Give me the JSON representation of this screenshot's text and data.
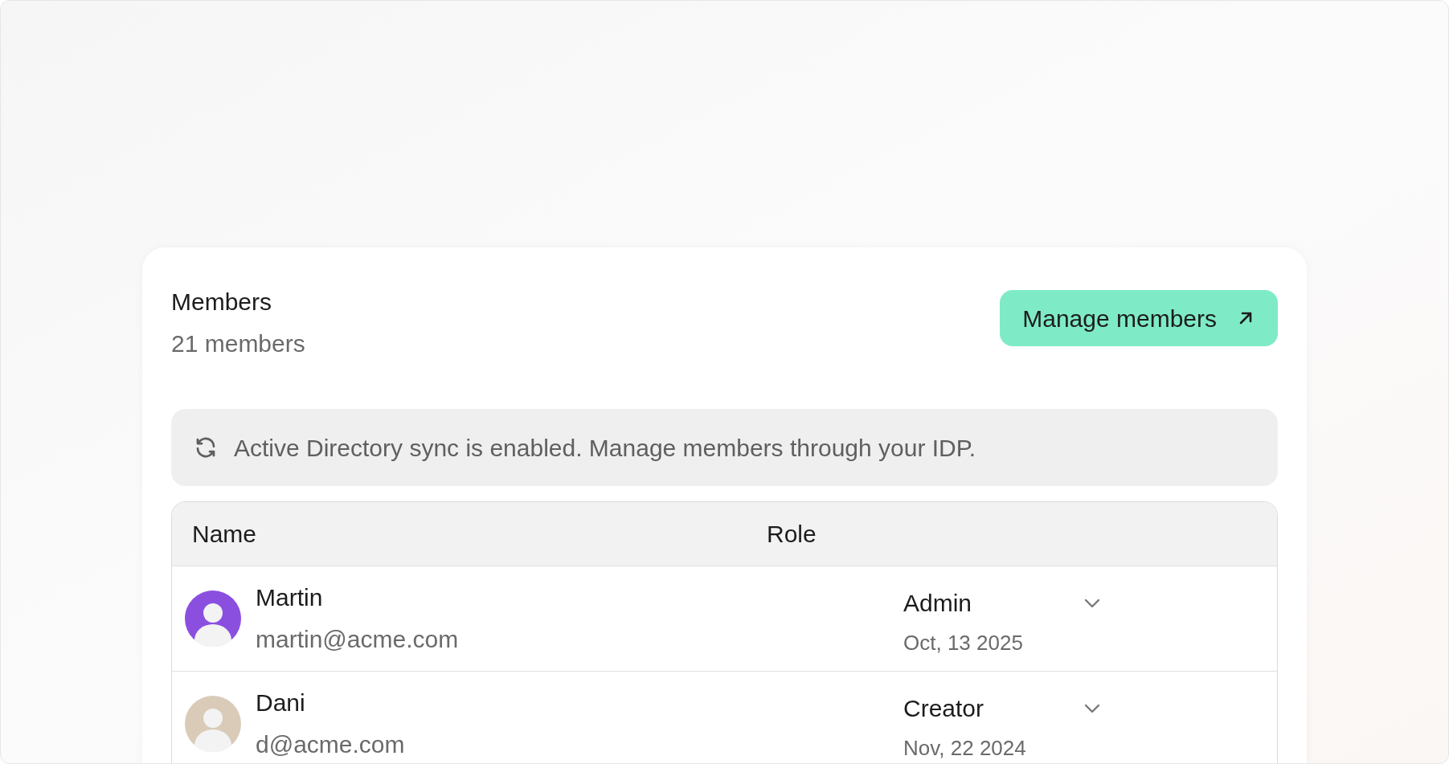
{
  "card": {
    "title": "Members",
    "subtitle": "21 members",
    "button": "Manage members"
  },
  "banner": {
    "text": "Active Directory sync is enabled. Manage members through your IDP."
  },
  "table": {
    "columns": [
      "Name",
      "Role"
    ],
    "rows": [
      {
        "name": "Martin",
        "email": "martin@acme.com",
        "role": "Admin",
        "date": "Oct, 13 2025",
        "color": "#8b4fe0"
      },
      {
        "name": "Dani",
        "email": "d@acme.com",
        "role": "Creator",
        "date": "Nov, 22 2024",
        "color": "#d9cbb8"
      }
    ]
  }
}
